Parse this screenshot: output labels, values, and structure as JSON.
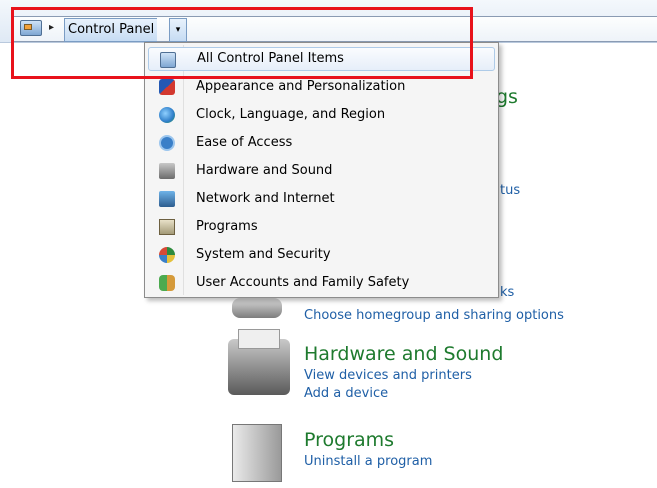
{
  "address_bar": {
    "crumb": "Control Panel",
    "separator": "▸",
    "dropdown_arrow": "▾",
    "icon": "control-panel-icon"
  },
  "menu": {
    "items": [
      {
        "label": "All Control Panel Items",
        "icon": "control-panel-icon",
        "selected": true
      },
      {
        "label": "Appearance and Personalization",
        "icon": "appearance-icon"
      },
      {
        "label": "Clock, Language, and Region",
        "icon": "clock-icon"
      },
      {
        "label": "Ease of Access",
        "icon": "ease-of-access-icon"
      },
      {
        "label": "Hardware and Sound",
        "icon": "hardware-icon"
      },
      {
        "label": "Network and Internet",
        "icon": "network-icon"
      },
      {
        "label": "Programs",
        "icon": "programs-icon"
      },
      {
        "label": "System and Security",
        "icon": "security-icon"
      },
      {
        "label": "User Accounts and Family Safety",
        "icon": "users-icon"
      }
    ]
  },
  "background": {
    "frag_gs": "gs",
    "frag_tus": "tus",
    "frag_ks": "ks",
    "homegroup_link": "Choose homegroup and sharing options",
    "hardware": {
      "title": "Hardware and Sound",
      "links": [
        "View devices and printers",
        "Add a device"
      ]
    },
    "programs": {
      "title": "Programs",
      "links": [
        "Uninstall a program"
      ]
    }
  },
  "colors": {
    "highlight": "#e8121b",
    "category_title": "#1e7a2e",
    "link": "#1f5fa6"
  }
}
